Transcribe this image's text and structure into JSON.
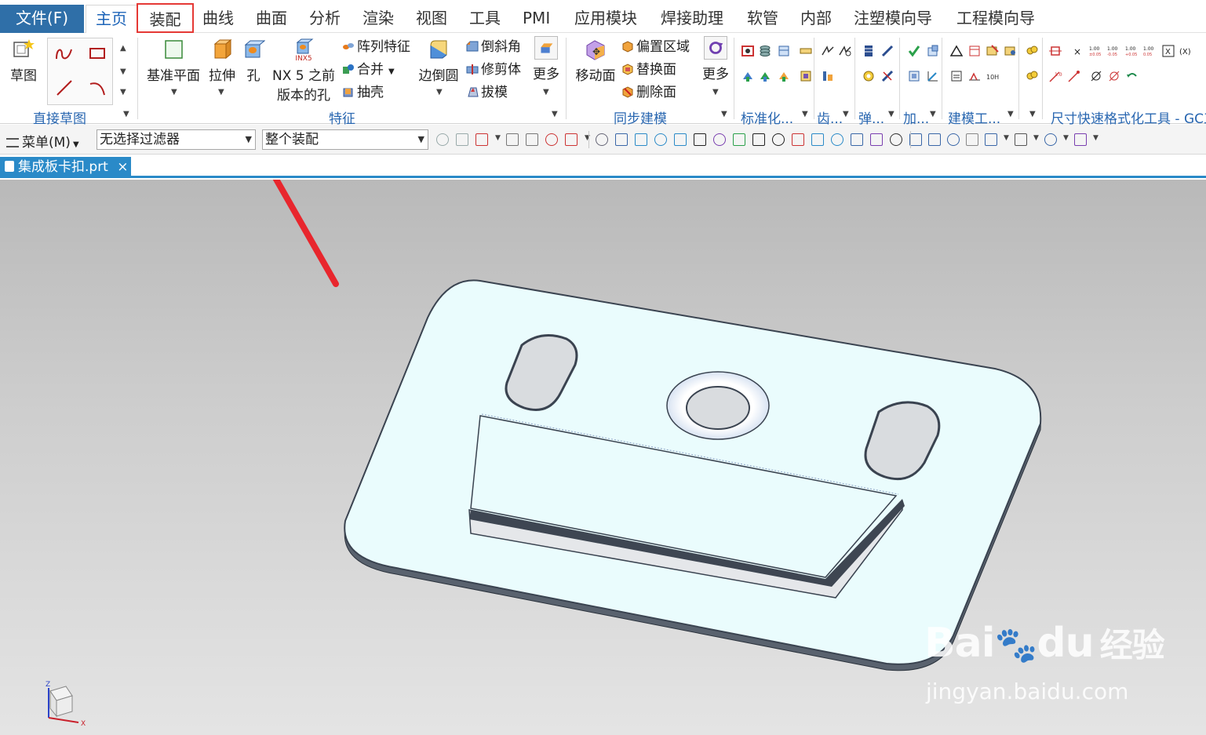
{
  "menubar": {
    "file": "文件(F)",
    "tabs": [
      "主页",
      "装配",
      "曲线",
      "曲面",
      "分析",
      "渲染",
      "视图",
      "工具",
      "PMI",
      "应用模块",
      "焊接助理",
      "软管",
      "内部",
      "注塑模向导",
      "工程模向导"
    ]
  },
  "ribbon": {
    "sketch": "草图",
    "direct_sketch": "直接草图",
    "datum_plane": "基准平面",
    "extrude": "拉伸",
    "hole": "孔",
    "nx5_hole_line1": "NX 5 之前",
    "nx5_hole_line2": "版本的孔",
    "nx5_badge": "INX5",
    "pattern": "阵列特征",
    "unite": "合并",
    "shell": "抽壳",
    "edge_blend": "边倒圆",
    "chamfer": "倒斜角",
    "trim_body": "修剪体",
    "draft": "拔模",
    "more1": "更多",
    "features": "特征",
    "move_face": "移动面",
    "offset_region": "偏置区域",
    "replace_face": "替换面",
    "delete_face": "删除面",
    "more2": "更多",
    "sync_modeling": "同步建模",
    "standard": "标准化...",
    "gear": "齿...",
    "spring": "弹...",
    "add": "加...",
    "modeling_tools": "建模工...",
    "dim_quick_format": "尺寸快速格式化工具 - GC工"
  },
  "toolbar": {
    "menu": "菜单(M)",
    "filter": "无选择过滤器",
    "scope": "整个装配"
  },
  "document": {
    "tab_label": "集成板卡扣.prt",
    "close": "×"
  },
  "triad": {
    "z": "Z",
    "x": "X"
  },
  "watermark": {
    "brand": "Bai",
    "brand2": "du",
    "cn": "经验",
    "url": "jingyan.baidu.com"
  },
  "colors": {
    "file_tab_bg": "#2f6fa8",
    "highlight_red": "#e53935",
    "group_label_blue": "#2866b0",
    "doc_tab_blue": "#2a8ac8",
    "part_face": "#e9fbfd",
    "part_edge": "#3a4350"
  }
}
